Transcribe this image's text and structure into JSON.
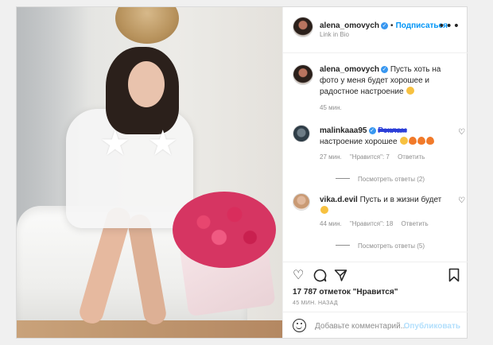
{
  "post": {
    "author": "alena_omovych",
    "follow_label": "Подписаться",
    "separator": "•",
    "location": "Link in Bio",
    "more_icon": "more-horizontal-icon"
  },
  "caption": {
    "author": "alena_omovych",
    "text": "Пусть хоть на фото у меня будет хорошее и радостное настроение",
    "emoji": "slightly-frowning-face",
    "time": "45 мин."
  },
  "comments": [
    {
      "author": "malinkaaa95",
      "verified": true,
      "redacted": "Реклам",
      "text": "настроение хорошее",
      "emojis": [
        "grinning-face",
        "fire",
        "fire",
        "fire"
      ],
      "time": "27 мин.",
      "likes": "\"Нравится\": 7",
      "reply": "Ответить",
      "view_replies": "Посмотреть ответы (2)"
    },
    {
      "author": "vika.d.evil",
      "verified": false,
      "text": "Пусть и в жизни будет",
      "emojis": [
        "grinning-face"
      ],
      "time": "44 мин.",
      "likes": "\"Нравится\": 18",
      "reply": "Ответить",
      "view_replies": "Посмотреть ответы (5)"
    }
  ],
  "actions": {
    "likes_text": "17 787 отметок \"Нравится\"",
    "time_ago": "45 МИН. НАЗАД",
    "add_comment_placeholder": "Добавьте комментарий...",
    "publish_label": "Опубликовать"
  },
  "colors": {
    "link_blue": "#0095f6",
    "verified_blue": "#3897f0",
    "muted": "#8e8e8e",
    "text": "#262626"
  }
}
